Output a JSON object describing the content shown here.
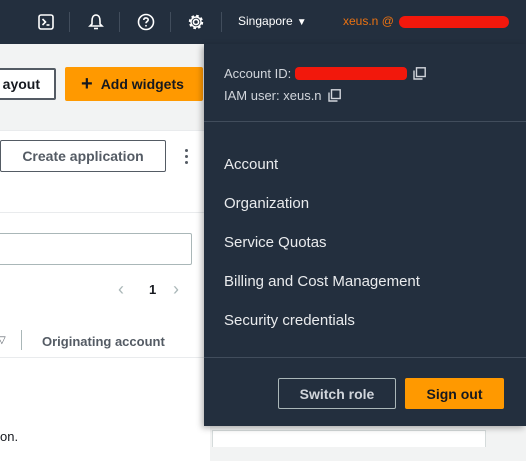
{
  "topbar": {
    "region": "Singapore",
    "user_label": "xeus.n @"
  },
  "background": {
    "layout_button": "ayout",
    "add_widgets_button": "Add widgets",
    "create_application_button": "Create application",
    "pager_page": "1",
    "column_header_originating": "Originating account",
    "row_text_fragment": "on."
  },
  "dropdown": {
    "account_id_label": "Account ID:",
    "iam_user_label": "IAM user: xeus.n",
    "menu_items": [
      "Account",
      "Organization",
      "Service Quotas",
      "Billing and Cost Management",
      "Security credentials"
    ],
    "switch_role_button": "Switch role",
    "sign_out_button": "Sign out"
  },
  "colors": {
    "nav_bg": "#232f3e",
    "accent_orange": "#ff9900",
    "user_text": "#ec7211",
    "redaction": "#f2180c"
  },
  "icons": [
    "cloudshell-icon",
    "notifications-icon",
    "help-icon",
    "settings-icon",
    "copy-icon"
  ]
}
